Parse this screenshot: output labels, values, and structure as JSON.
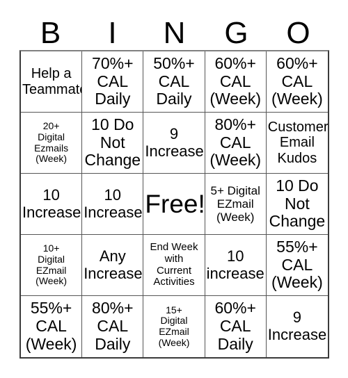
{
  "card": {
    "title": "BINGO",
    "header_letters": [
      "B",
      "I",
      "N",
      "G",
      "O"
    ],
    "free_space_label": "Free!",
    "columns": 5,
    "rows": 5,
    "colors": {
      "background": "#ffffff",
      "text": "#000000",
      "grid_line": "#555555",
      "grid_border": "#3a3a3a"
    },
    "cells": [
      {
        "id": "b1",
        "column": "B",
        "row": 1,
        "text": "Help a\nTeammate",
        "size": "sm",
        "marked": false
      },
      {
        "id": "i1",
        "column": "I",
        "row": 1,
        "text": "70%+\nCAL\nDaily",
        "size": "lg",
        "marked": false
      },
      {
        "id": "n1",
        "column": "N",
        "row": 1,
        "text": "50%+\nCAL\nDaily",
        "size": "lg",
        "marked": false
      },
      {
        "id": "g1",
        "column": "G",
        "row": 1,
        "text": "60%+\nCAL\n(Week)",
        "size": "lg",
        "marked": false
      },
      {
        "id": "o1",
        "column": "O",
        "row": 1,
        "text": "60%+\nCAL\n(Week)",
        "size": "lg",
        "marked": false
      },
      {
        "id": "b2",
        "column": "B",
        "row": 2,
        "text": "20+\nDigital\nEzmails\n(Week)",
        "size": "tiny",
        "marked": false
      },
      {
        "id": "i2",
        "column": "I",
        "row": 2,
        "text": "10 Do\nNot\nChange",
        "size": "lg",
        "marked": false
      },
      {
        "id": "n2",
        "column": "N",
        "row": 2,
        "text": "9\nIncrease",
        "size": "md",
        "marked": false
      },
      {
        "id": "g2",
        "column": "G",
        "row": 2,
        "text": "80%+\nCAL\n(Week)",
        "size": "lg",
        "marked": false
      },
      {
        "id": "o2",
        "column": "O",
        "row": 2,
        "text": "Customer\nEmail\nKudos",
        "size": "sm",
        "marked": false
      },
      {
        "id": "b3",
        "column": "B",
        "row": 3,
        "text": "10\nIncrease",
        "size": "md",
        "marked": false
      },
      {
        "id": "i3",
        "column": "I",
        "row": 3,
        "text": "10\nIncrease",
        "size": "md",
        "marked": false
      },
      {
        "id": "n3",
        "column": "N",
        "row": 3,
        "text": "Free!",
        "size": "xl",
        "marked": true
      },
      {
        "id": "g3",
        "column": "G",
        "row": 3,
        "text": "5+ Digital\nEZmail\n(Week)",
        "size": "xs",
        "marked": false
      },
      {
        "id": "o3",
        "column": "O",
        "row": 3,
        "text": "10 Do\nNot\nChange",
        "size": "lg",
        "marked": false
      },
      {
        "id": "b4",
        "column": "B",
        "row": 4,
        "text": "10+\nDigital\nEZmail\n(Week)",
        "size": "tiny",
        "marked": false
      },
      {
        "id": "i4",
        "column": "I",
        "row": 4,
        "text": "Any\nIncrease",
        "size": "md",
        "marked": false
      },
      {
        "id": "n4",
        "column": "N",
        "row": 4,
        "text": "End Week\nwith\nCurrent\nActivities",
        "size": "xxs",
        "marked": false
      },
      {
        "id": "g4",
        "column": "G",
        "row": 4,
        "text": "10\nincrease",
        "size": "md",
        "marked": false
      },
      {
        "id": "o4",
        "column": "O",
        "row": 4,
        "text": "55%+\nCAL\n(Week)",
        "size": "lg",
        "marked": false
      },
      {
        "id": "b5",
        "column": "B",
        "row": 5,
        "text": "55%+\nCAL\n(Week)",
        "size": "lg",
        "marked": false
      },
      {
        "id": "i5",
        "column": "I",
        "row": 5,
        "text": "80%+\nCAL\nDaily",
        "size": "lg",
        "marked": false
      },
      {
        "id": "n5",
        "column": "N",
        "row": 5,
        "text": "15+\nDigital\nEZmail\n(Week)",
        "size": "tiny",
        "marked": false
      },
      {
        "id": "g5",
        "column": "G",
        "row": 5,
        "text": "60%+\nCAL\nDaily",
        "size": "lg",
        "marked": false
      },
      {
        "id": "o5",
        "column": "O",
        "row": 5,
        "text": "9\nIncrease",
        "size": "md",
        "marked": false
      }
    ]
  }
}
